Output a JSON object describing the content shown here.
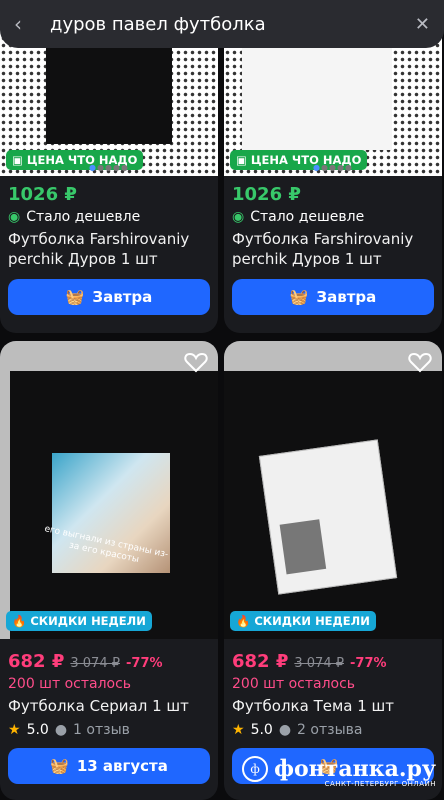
{
  "search": {
    "query": "дуров павел футболка"
  },
  "products": [
    {
      "badge": "ЦЕНА ЧТО НАДО",
      "price": "1026 ₽",
      "note": "Стало дешевле",
      "title": "Футболка Farshirovaniy perchik Дуров 1 шт",
      "button": "Завтра"
    },
    {
      "badge": "ЦЕНА ЧТО НАДО",
      "price": "1026 ₽",
      "note": "Стало дешевле",
      "title": "Футболка Farshirovaniy perchik Дуров 1 шт",
      "button": "Завтра"
    },
    {
      "badge": "СКИДКИ НЕДЕЛИ",
      "price": "682 ₽",
      "old_price": "3 074 ₽",
      "discount": "-77%",
      "stock": "200 шт осталось",
      "title": "Футболка Сериал 1 шт",
      "rating": "5.0",
      "reviews": "1 отзыв",
      "button": "13 августа",
      "print_text": "его выгнали из страны из-за его красоты"
    },
    {
      "badge": "СКИДКИ НЕДЕЛИ",
      "price": "682 ₽",
      "old_price": "3 074 ₽",
      "discount": "-77%",
      "stock": "200 шт осталось",
      "title": "Футболка Тема 1 шт",
      "rating": "5.0",
      "reviews": "2 отзыва",
      "button": ""
    }
  ],
  "watermark": {
    "name": "фонтанка.ру",
    "city": "САНКТ-ПЕТЕРБУРГ ОНЛАЙН"
  },
  "colors": {
    "accent": "#1f67ff",
    "green": "#38c86a",
    "pink": "#ff3d7b",
    "badge_green": "#18a74a",
    "badge_blue": "#16a7d6"
  }
}
